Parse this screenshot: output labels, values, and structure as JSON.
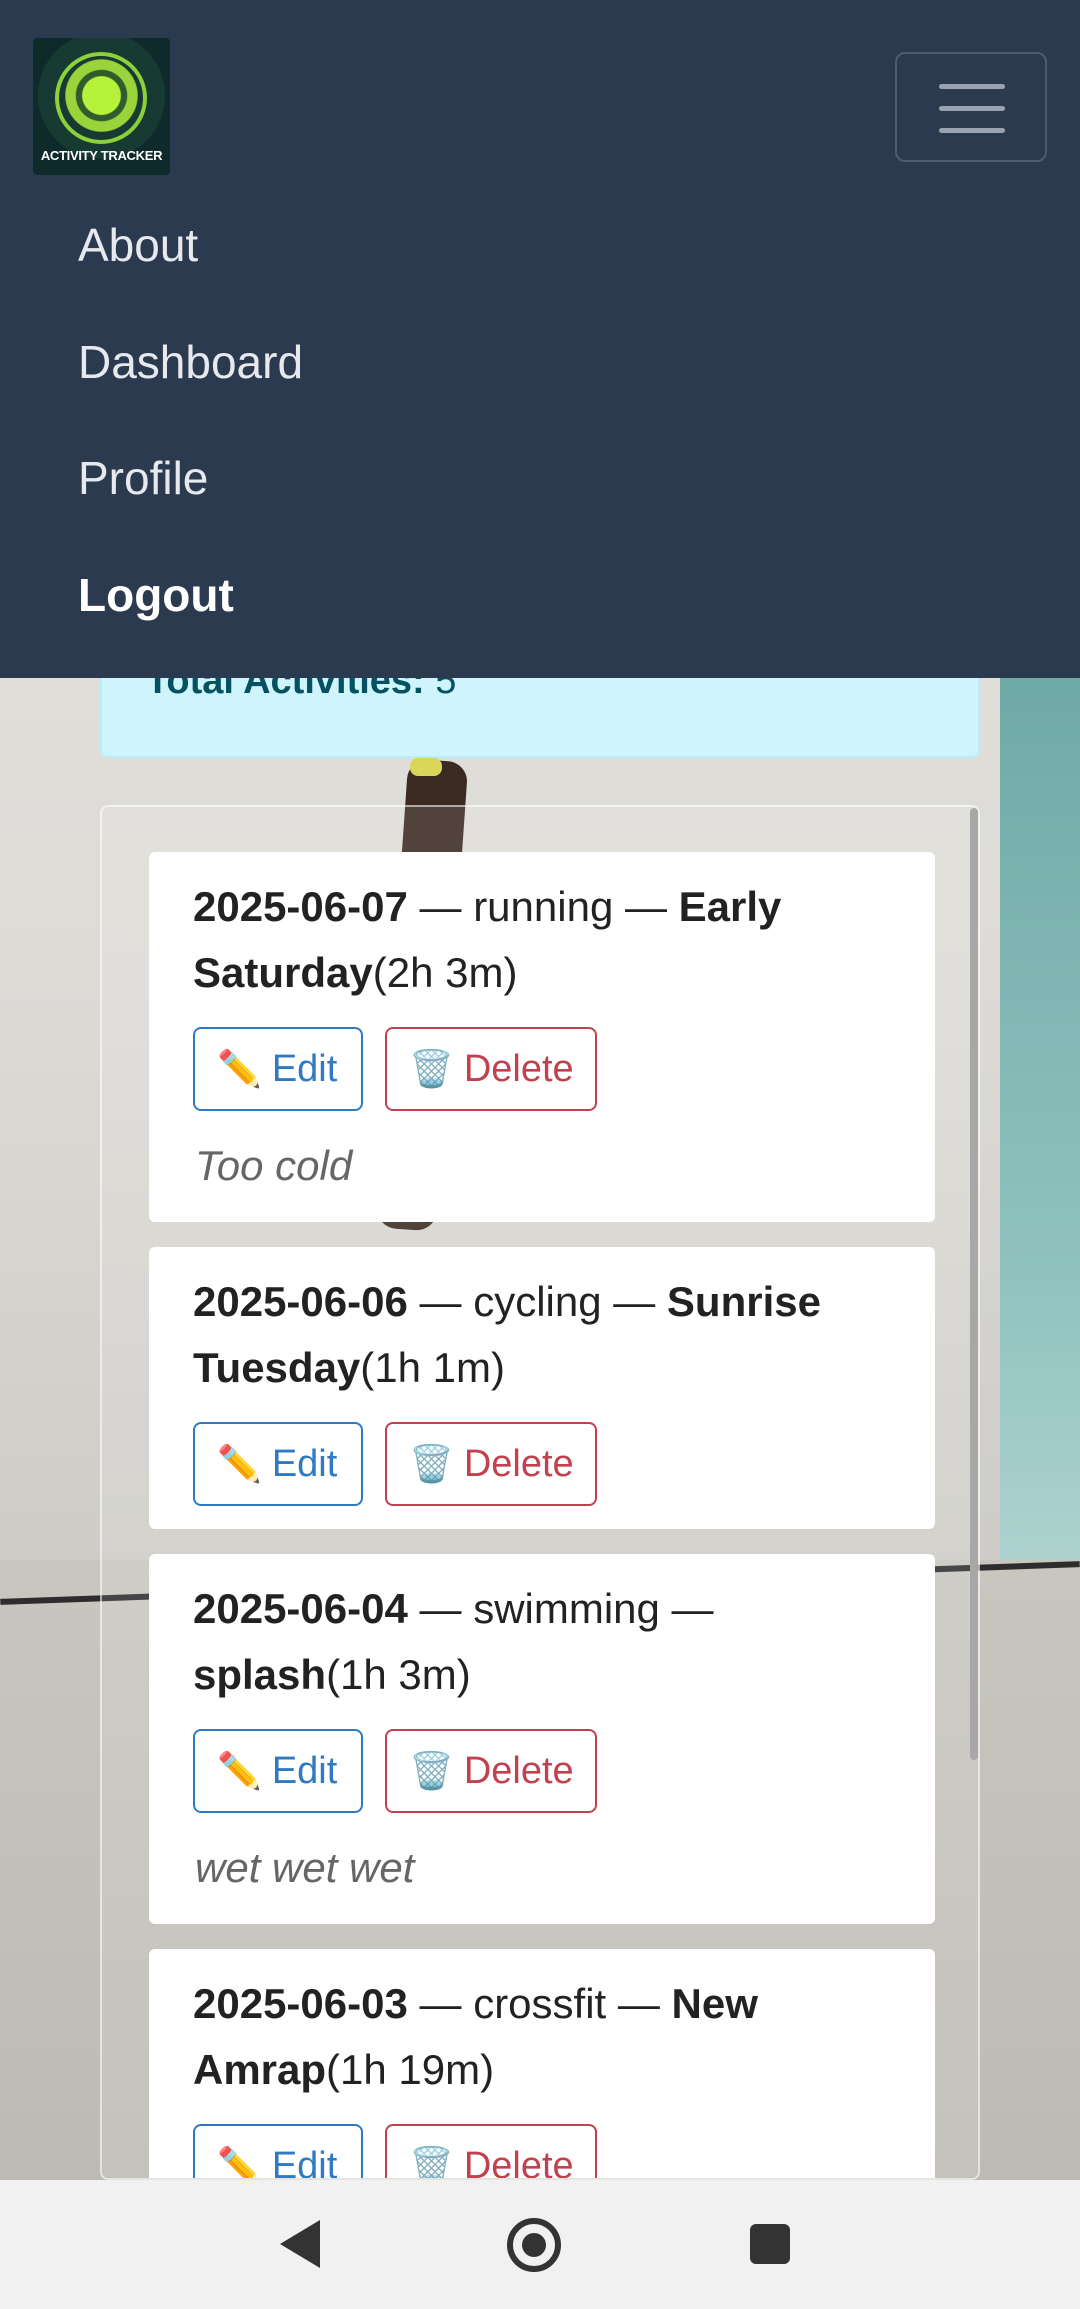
{
  "navbar": {
    "logo_text": "ACTIVITY TRACKER",
    "menu": [
      "About",
      "Dashboard",
      "Profile",
      "Logout"
    ]
  },
  "stats": {
    "label": "Total Activities:",
    "value": "5"
  },
  "activities": [
    {
      "date": "2025-06-07",
      "type": "running",
      "title_line1": "Early",
      "title_line2": "Saturday",
      "duration": "(2h 3m)",
      "note": "Too cold"
    },
    {
      "date": "2025-06-06",
      "type": "cycling",
      "title_line1": "Sunrise",
      "title_line2": "Tuesday",
      "duration": "(1h 1m)",
      "note": ""
    },
    {
      "date": "2025-06-04",
      "type": "swimming",
      "title_line1": "",
      "title_line2": "splash",
      "duration": "(1h 3m)",
      "note": "wet wet wet"
    },
    {
      "date": "2025-06-03",
      "type": "crossfit",
      "title_line1": "New",
      "title_line2": "Amrap",
      "duration": "(1h 19m)",
      "note": ""
    }
  ],
  "buttons": {
    "edit": "Edit",
    "delete": "Delete",
    "edit_icon": "✏️",
    "delete_icon": "🗑️"
  },
  "separator": " — ",
  "colors": {
    "navbar": "#2c3a4f",
    "edit": "#2f7ac0",
    "delete": "#c2414e",
    "info_bg": "#cff4fc"
  }
}
